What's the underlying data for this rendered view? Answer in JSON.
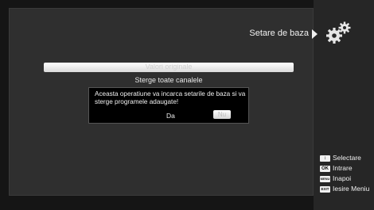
{
  "header": {
    "title": "Setare de baza",
    "icon": "gears-icon"
  },
  "menu": {
    "selected_item": "Valori originale",
    "item": "Sterge toate canalele"
  },
  "dialog": {
    "message": "Aceasta operatiune va incarca setarile de baza si va sterge programele adaugate!",
    "yes_label": "Da",
    "no_label": "Nu"
  },
  "legend": [
    {
      "key": "↕",
      "label": "Selectare"
    },
    {
      "key": "OK",
      "label": "Intrare"
    },
    {
      "key": "MENU",
      "label": "Inapoi"
    },
    {
      "key": "EXIT",
      "label": "Iesire Meniu"
    }
  ],
  "colors": {
    "panel": "#2f2f2f",
    "sidebar": "#262626",
    "highlight": "#ffffff"
  }
}
